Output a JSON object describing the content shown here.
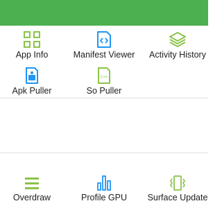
{
  "colors": {
    "header_green": "#4caf50",
    "accent_green": "#8bc34a",
    "accent_blue": "#2196f3",
    "text": "#212121",
    "divider": "#e0e0e0"
  },
  "grid": {
    "items": [
      {
        "label": "App Info",
        "icon": "grid-apps-icon"
      },
      {
        "label": "Manifest Viewer",
        "icon": "code-file-icon"
      },
      {
        "label": "Activity History",
        "icon": "layers-icon"
      },
      {
        "label": "Apk Puller",
        "icon": "apk-file-icon"
      },
      {
        "label": "So Puller",
        "icon": "so-file-icon"
      }
    ]
  },
  "bottom": {
    "items": [
      {
        "label": "Overdraw",
        "icon": "menu-lines-icon"
      },
      {
        "label": "Profile GPU",
        "icon": "bar-chart-icon"
      },
      {
        "label": "Surface Update",
        "icon": "vibrate-icon"
      }
    ]
  }
}
